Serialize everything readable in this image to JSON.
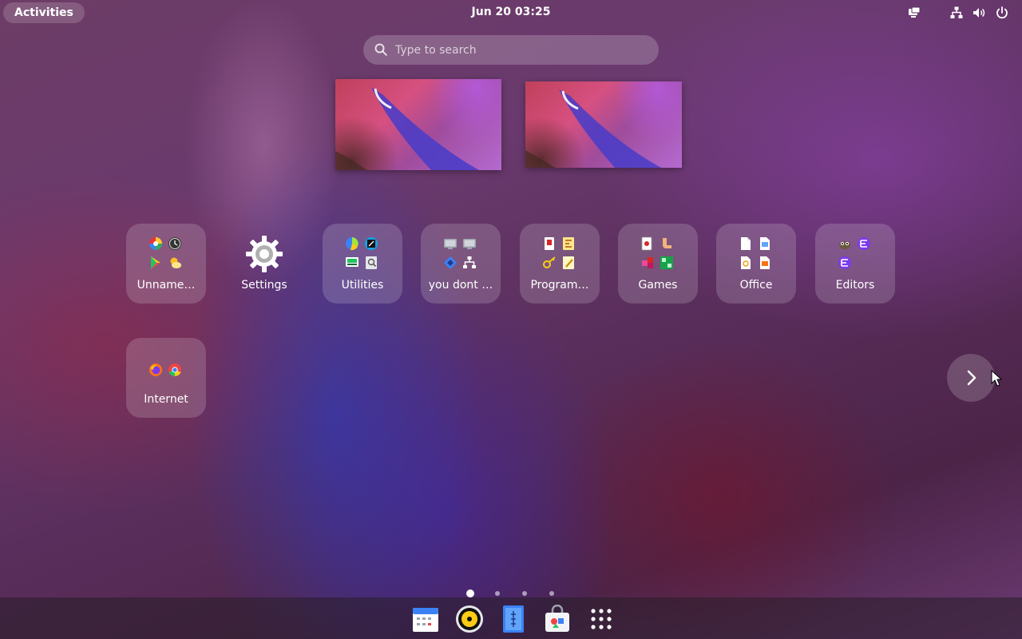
{
  "topbar": {
    "activities_label": "Activities",
    "clock": "Jun 20  03:25",
    "tray_icons": [
      "display-icon",
      "network-icon",
      "volume-icon",
      "power-icon"
    ]
  },
  "search": {
    "placeholder": "Type to search"
  },
  "workspaces": [
    "workspace-1",
    "workspace-2"
  ],
  "app_grid": {
    "folders": [
      {
        "label": "Unname…",
        "icons": [
          "color-picker-icon",
          "clock-icon",
          "play-store-icon",
          "weather-icon"
        ]
      },
      {
        "label": "Settings",
        "icons": [
          "gear-icon"
        ]
      },
      {
        "label": "Utilities",
        "icons": [
          "disk-usage-icon",
          "screenshot-icon",
          "monitor-icon",
          "document-scanner-icon"
        ]
      },
      {
        "label": "you dont …",
        "icons": [
          "terminal-icon",
          "terminal-icon",
          "connection-icon",
          "network-tree-icon"
        ]
      },
      {
        "label": "Program…",
        "icons": [
          "red-app-icon",
          "diff-tool-icon",
          "key-icon",
          "text-editor-icon"
        ]
      },
      {
        "label": "Games",
        "icons": [
          "solitaire-icon",
          "arm-icon",
          "puzzle-icon",
          "mines-icon"
        ]
      },
      {
        "label": "Office",
        "icons": [
          "document-icon",
          "spreadsheet-icon",
          "draw-icon",
          "presentation-icon"
        ]
      },
      {
        "label": "Editors",
        "icons": [
          "gimp-icon",
          "emacs-icon",
          "emacs-icon"
        ]
      },
      {
        "label": "Internet",
        "icons": [
          "firefox-icon",
          "chrome-icon"
        ]
      }
    ],
    "page_count": 4,
    "current_page": 1
  },
  "dock": [
    "calendar-icon",
    "rhythmbox-icon",
    "text-editor-icon",
    "software-store-icon",
    "show-apps-icon"
  ]
}
